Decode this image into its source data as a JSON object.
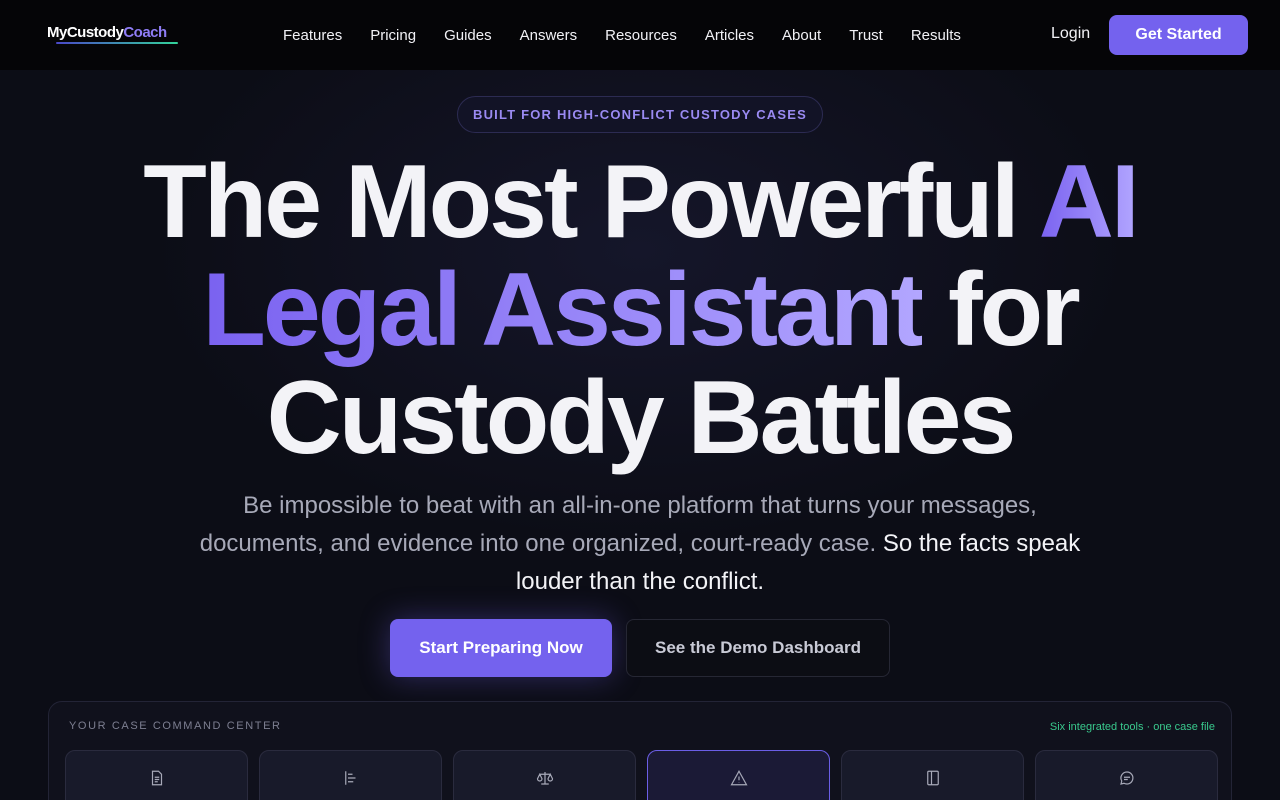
{
  "nav": {
    "logo_part1": "MyCustody",
    "logo_part2": "Coach",
    "links": [
      "Features",
      "Pricing",
      "Guides",
      "Answers",
      "Resources",
      "Articles",
      "About",
      "Trust",
      "Results"
    ],
    "login": "Login",
    "get_started": "Get Started"
  },
  "hero": {
    "badge": "BUILT FOR HIGH-CONFLICT CUSTODY CASES",
    "headline_line1_plain": "The Most Powerful ",
    "headline_line1_accent": "AI",
    "headline_line2_accent": "Legal Assistant",
    "headline_line2_plain": " for",
    "headline_line3": "Custody Battles",
    "sub_plain": "Be impossible to beat with an all-in-one platform that turns your messages, documents, and evidence into one organized, court-ready case.",
    "sub_strong": "So the facts speak louder than the conflict.",
    "cta_primary": "Start Preparing Now",
    "cta_secondary": "See the Demo Dashboard"
  },
  "command_center": {
    "label": "YOUR CASE COMMAND CENTER",
    "meta": "Six integrated tools · one case file",
    "tools": [
      {
        "icon": "document-icon",
        "active": false
      },
      {
        "icon": "timeline-icon",
        "active": false
      },
      {
        "icon": "scales-icon",
        "active": false
      },
      {
        "icon": "warning-icon",
        "active": true
      },
      {
        "icon": "notebook-icon",
        "active": false
      },
      {
        "icon": "chat-icon",
        "active": false
      }
    ]
  }
}
